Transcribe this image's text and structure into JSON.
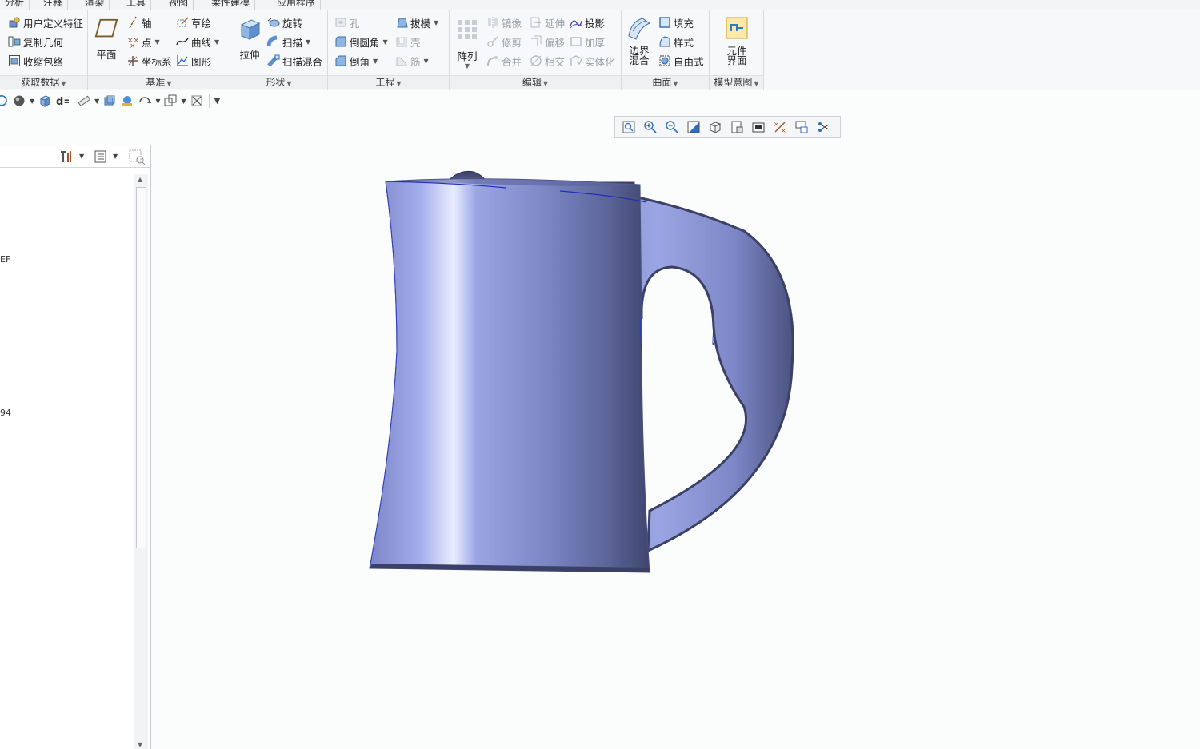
{
  "tabs": [
    "分析",
    "注释",
    "渲染",
    "工具",
    "视图",
    "柔性建模",
    "应用程序"
  ],
  "ribbon": {
    "get_data": {
      "label": "获取数据",
      "items": [
        "用户定义特征",
        "复制几何",
        "收缩包络"
      ]
    },
    "datum": {
      "label": "基准",
      "plane": "平面",
      "col1": [
        "轴",
        "点",
        "坐标系"
      ],
      "col2": [
        "草绘",
        "曲线",
        "图形"
      ]
    },
    "shape": {
      "label": "形状",
      "extrude": "拉伸",
      "items": [
        "旋转",
        "扫描",
        "扫描混合"
      ]
    },
    "engineering": {
      "label": "工程",
      "col1": [
        "孔",
        "倒圆角",
        "倒角"
      ],
      "col2": [
        "拔模",
        "壳",
        "筋"
      ]
    },
    "editing": {
      "label": "编辑",
      "pattern": "阵列",
      "col1": [
        "镜像",
        "修剪",
        "合并"
      ],
      "col2": [
        "延伸",
        "偏移",
        "相交"
      ],
      "col3": [
        "投影",
        "加厚",
        "实体化"
      ]
    },
    "surfaces": {
      "label": "曲面",
      "boundary_blend": [
        "边界",
        "混合"
      ],
      "items": [
        "填充",
        "样式",
        "自由式"
      ]
    },
    "model_intent": {
      "label": "模型意图",
      "component_interface": [
        "元件",
        "界面"
      ]
    }
  },
  "left_panel": {
    "fragment_1": "EF",
    "fragment_2": "94"
  },
  "colors": {
    "model": "#8f99d9",
    "model_dark": "#3c4273",
    "edge": "#1f2fb8",
    "background": "#fbfcfc"
  }
}
